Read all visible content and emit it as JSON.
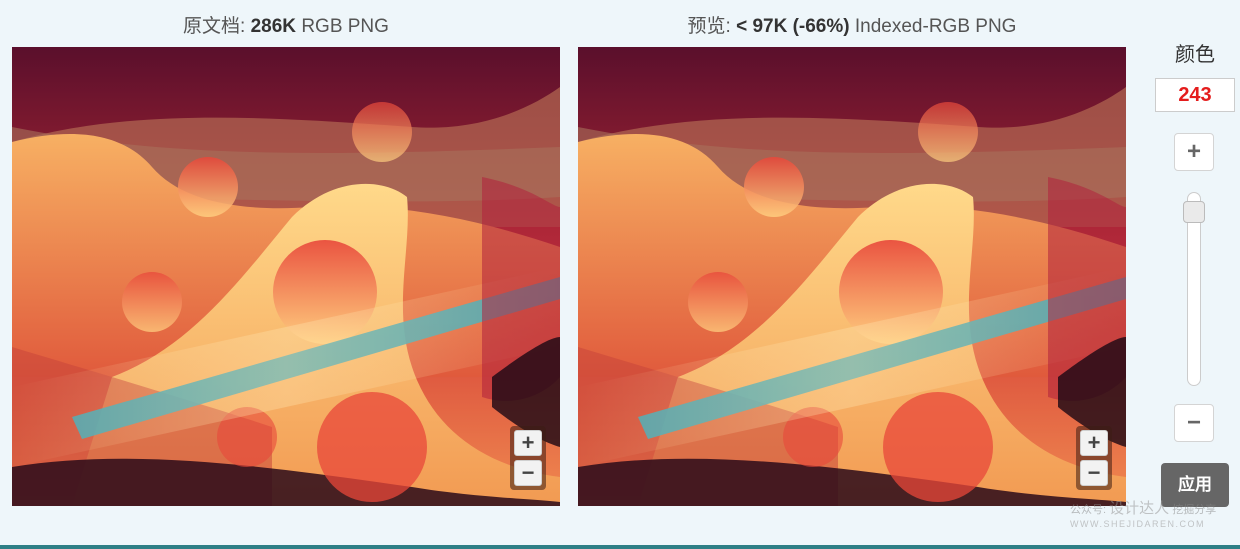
{
  "original": {
    "label": "原文档:",
    "size": "286K",
    "format": "RGB PNG"
  },
  "preview": {
    "label": "预览:",
    "size": "< 97K (-66%)",
    "format": "Indexed-RGB PNG"
  },
  "zoom": {
    "plus": "+",
    "minus": "−"
  },
  "sidebar": {
    "colors_label": "颜色",
    "colors_value": "243",
    "plus_label": "+",
    "minus_label": "−",
    "slider_level": 0.05,
    "apply_label": "应用"
  },
  "watermark": {
    "prefix": "公众号:",
    "name": "设计达人",
    "tagline": "挖掘分享",
    "url": "WWW.SHEJIDAREN.COM"
  },
  "colors": {
    "accent_red": "#e41c1c",
    "apply_bg": "#666666",
    "bottom_bar": "#2e7f86"
  }
}
